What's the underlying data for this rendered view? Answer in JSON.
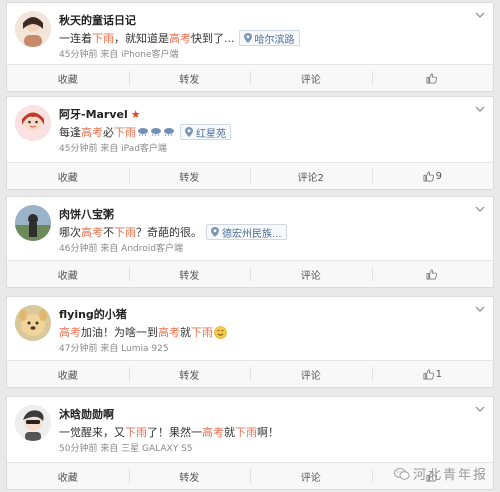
{
  "posts": [
    {
      "name": "秋天的童话日记",
      "text": [
        {
          "t": "一连着"
        },
        {
          "t": "下雨",
          "hl": true
        },
        {
          "t": "，就知道是"
        },
        {
          "t": "高考",
          "hl": true
        },
        {
          "t": "快到了..."
        }
      ],
      "location": "哈尔滨路",
      "meta": "45分钟前 来自 iPhone客户端",
      "actions": {
        "repost": "收藏",
        "forward": "转发",
        "comment": "评论",
        "like": ""
      }
    },
    {
      "name": "阿牙-Marvel",
      "vip": true,
      "text": [
        {
          "t": "每逢"
        },
        {
          "t": "高考",
          "hl": true
        },
        {
          "t": " 必"
        },
        {
          "t": "下雨",
          "hl": true
        }
      ],
      "location": "红星苑",
      "meta": "45分钟前 来自 iPad客户端",
      "actions": {
        "repost": "收藏",
        "forward": "转发",
        "comment": "评论2",
        "like": "9"
      }
    },
    {
      "name": "肉饼八宝粥",
      "text": [
        {
          "t": "哪次"
        },
        {
          "t": "高考",
          "hl": true
        },
        {
          "t": "不"
        },
        {
          "t": "下雨",
          "hl": true
        },
        {
          "t": "？奇葩的很。"
        }
      ],
      "location": "德宏州民族...",
      "meta": "46分钟前 来自 Android客户端",
      "actions": {
        "repost": "收藏",
        "forward": "转发",
        "comment": "评论",
        "like": ""
      }
    },
    {
      "name": "flying的小猪",
      "text": [
        {
          "t": "高考",
          "hl": true
        },
        {
          "t": "加油！为啥一到"
        },
        {
          "t": "高考",
          "hl": true
        },
        {
          "t": "就"
        },
        {
          "t": "下雨",
          "hl": true
        }
      ],
      "meta": "47分钟前 来自 Lumia 925",
      "actions": {
        "repost": "收藏",
        "forward": "转发",
        "comment": "评论",
        "like": "1"
      }
    },
    {
      "name": "沐晗勋勋啊",
      "text": [
        {
          "t": "一觉醒来，又"
        },
        {
          "t": "下雨",
          "hl": true
        },
        {
          "t": "了！果然一"
        },
        {
          "t": "高考",
          "hl": true
        },
        {
          "t": "就"
        },
        {
          "t": "下雨",
          "hl": true
        },
        {
          "t": "啊！"
        }
      ],
      "meta": "50分钟前 来自 三星 GALAXY S5",
      "actions": {
        "repost": "收藏",
        "forward": "转发",
        "comment": "评论",
        "like": ""
      }
    }
  ],
  "watermark": "河北青年报",
  "colors": {
    "highlight": "#eb7350",
    "link": "#4d6f9c",
    "vip": "#e2451a"
  },
  "icons": {
    "location": "map-pin-icon",
    "like": "thumbs-up-icon",
    "more": "chevron-down-icon",
    "weather": "rain-cloud-icon",
    "emoji": "smiling-face-icon",
    "watermark": "wechat-icon"
  }
}
